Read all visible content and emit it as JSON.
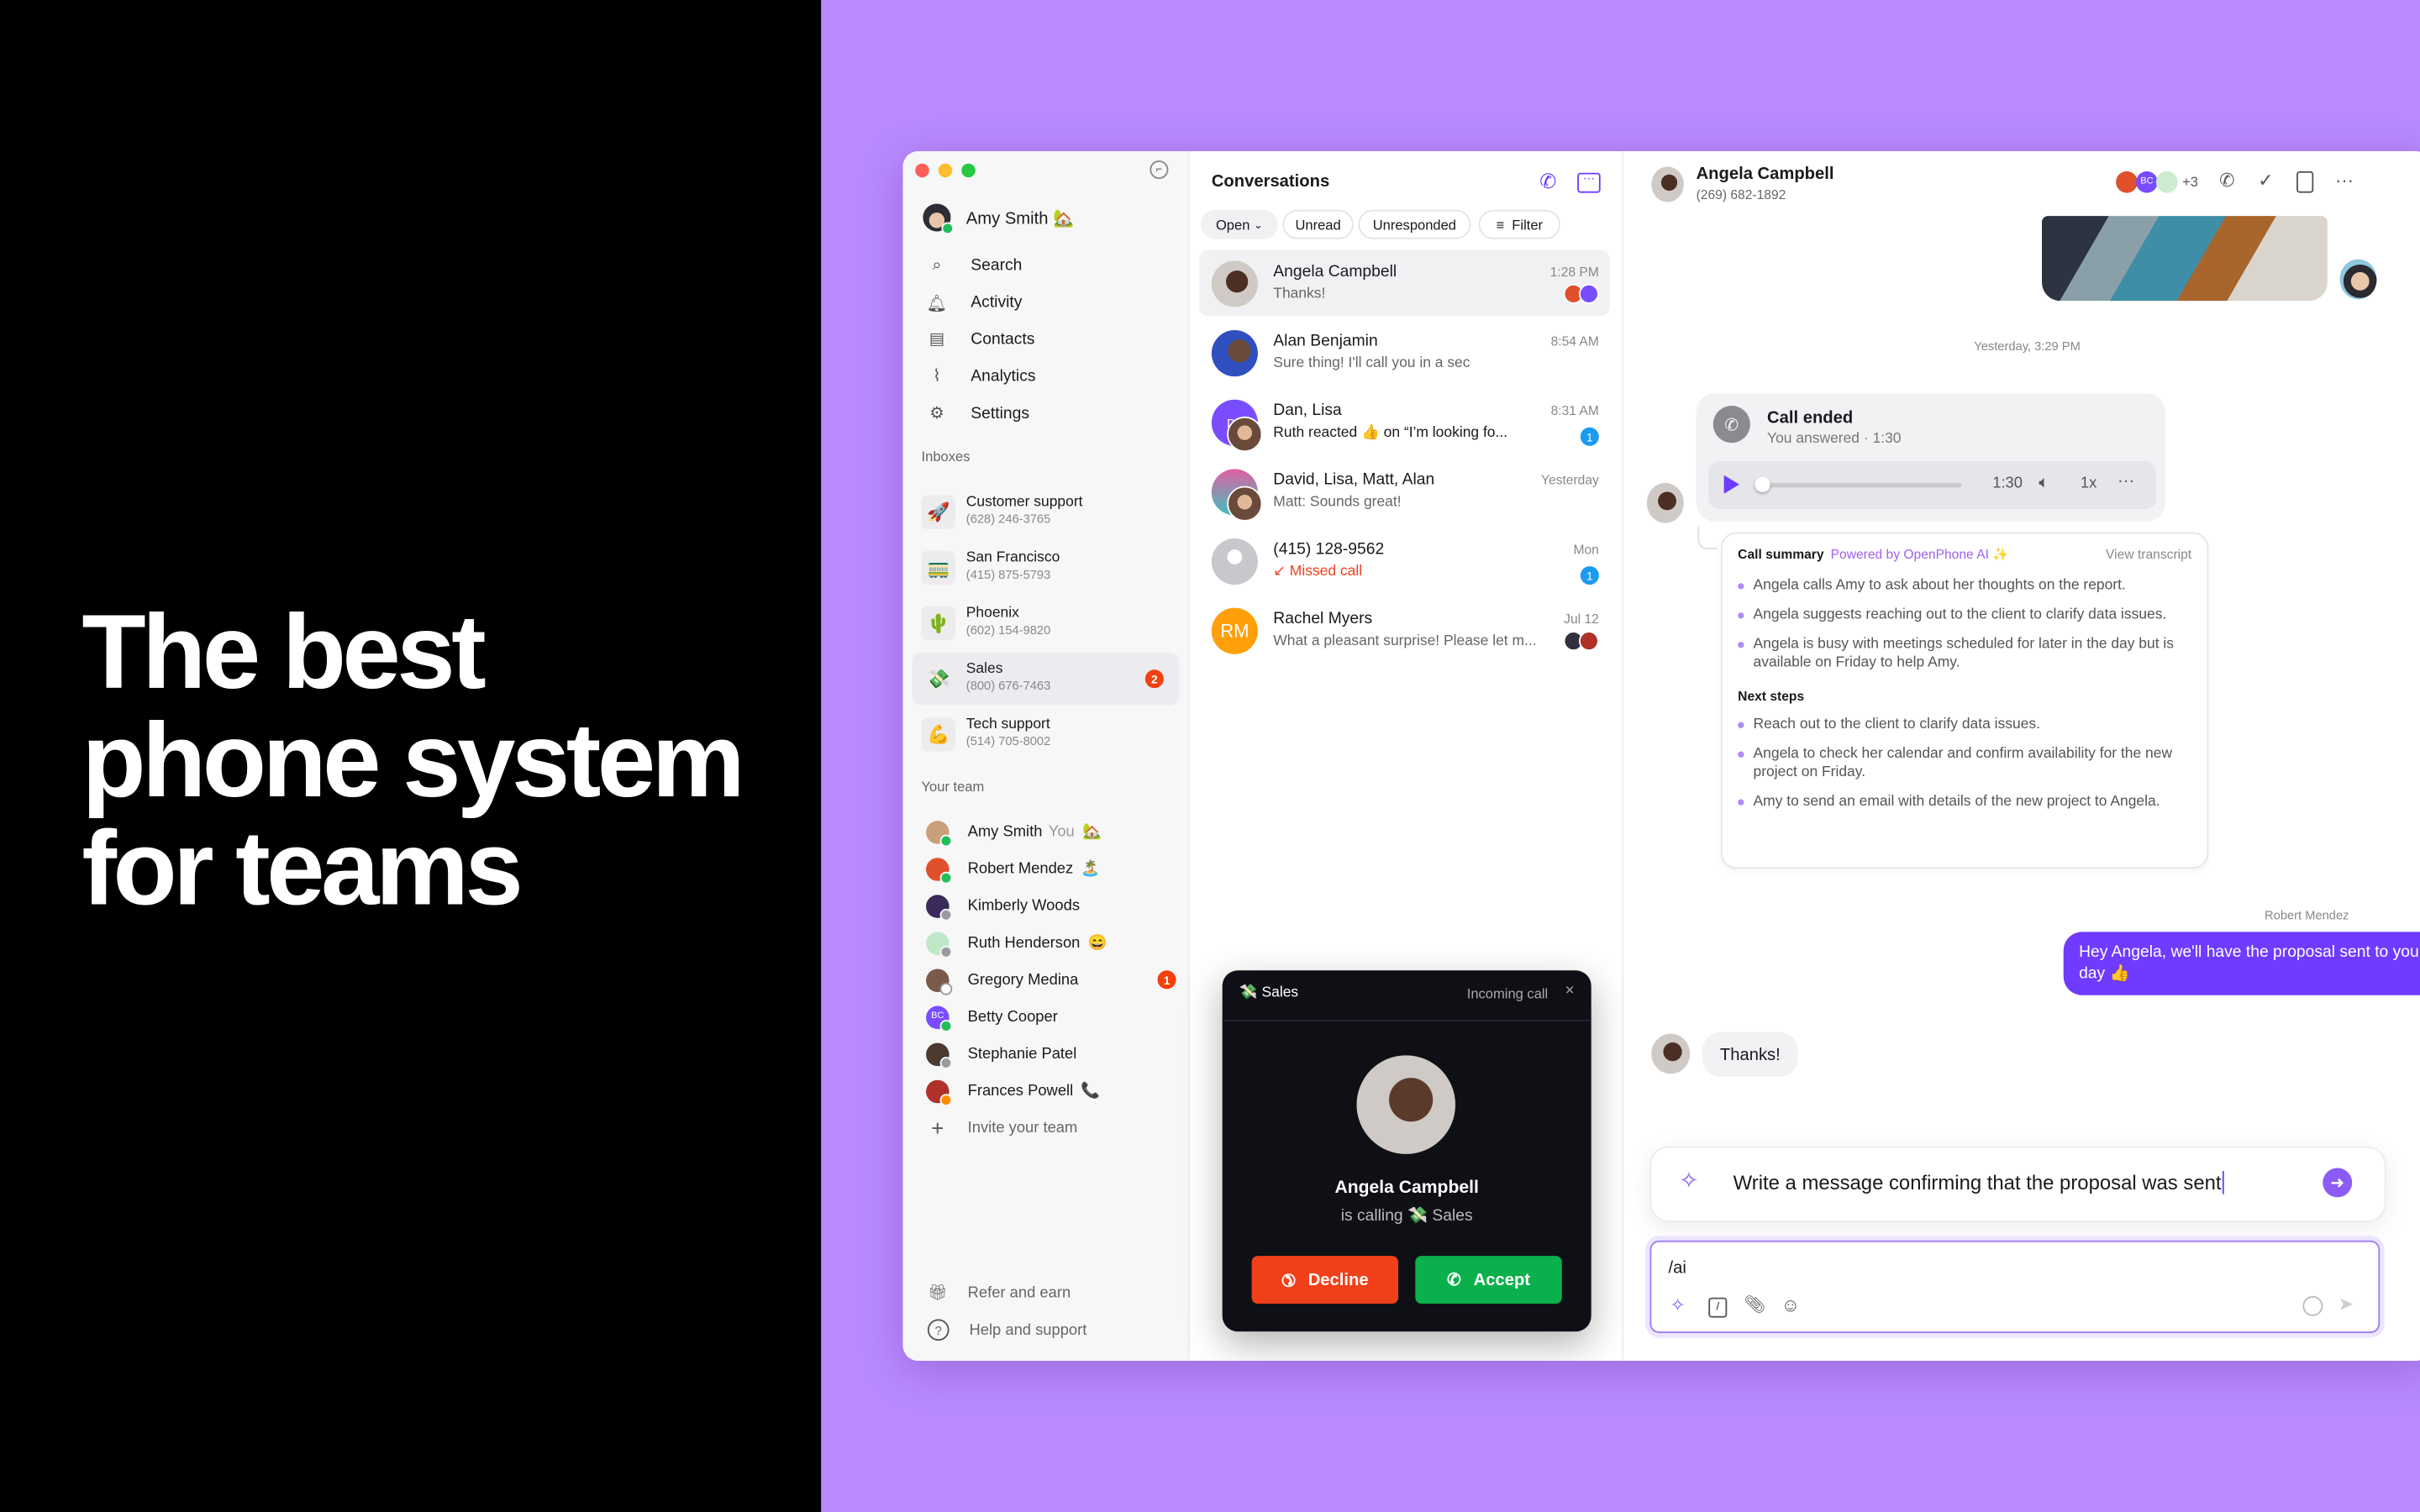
{
  "headline": {
    "line1": "The best",
    "line2": "phone system",
    "line3": "for teams"
  },
  "colors": {
    "accent": "#6f3bff",
    "background": "#b98bff",
    "decline": "#f0401a",
    "accept": "#0ab04b",
    "unread_badge": "#1a9bf0",
    "alert_badge": "#f2400f"
  },
  "sidebar": {
    "user": {
      "name": "Amy Smith",
      "status_emoji": "🏡"
    },
    "nav": [
      {
        "label": "Search",
        "icon": "search-icon"
      },
      {
        "label": "Activity",
        "icon": "bell-icon"
      },
      {
        "label": "Contacts",
        "icon": "contacts-icon"
      },
      {
        "label": "Analytics",
        "icon": "analytics-icon"
      },
      {
        "label": "Settings",
        "icon": "gear-icon"
      }
    ],
    "inboxes_label": "Inboxes",
    "inboxes": [
      {
        "emoji": "🚀",
        "name": "Customer support",
        "phone": "(628) 246-3765"
      },
      {
        "emoji": "🚃",
        "name": "San Francisco",
        "phone": "(415) 875-5793"
      },
      {
        "emoji": "🌵",
        "name": "Phoenix",
        "phone": "(602) 154-9820"
      },
      {
        "emoji": "💸",
        "name": "Sales",
        "phone": "(800) 676-7463",
        "badge": "2"
      },
      {
        "emoji": "💪",
        "name": "Tech support",
        "phone": "(514) 705-8002"
      }
    ],
    "team_label": "Your team",
    "team": [
      {
        "name": "Amy Smith",
        "you": "You",
        "emoji": "🏡",
        "status": "online"
      },
      {
        "name": "Robert Mendez",
        "emoji": "🏝️",
        "status": "online"
      },
      {
        "name": "Kimberly Woods",
        "status": "away"
      },
      {
        "name": "Ruth Henderson",
        "emoji": "😄",
        "status": "away"
      },
      {
        "name": "Gregory Medina",
        "status": "offline",
        "badge": "1"
      },
      {
        "name": "Betty Cooper",
        "initials": "BC",
        "status": "online"
      },
      {
        "name": "Stephanie Patel",
        "status": "away"
      },
      {
        "name": "Frances Powell",
        "emoji": "📞",
        "status": "busy"
      }
    ],
    "invite": "Invite your team",
    "refer": "Refer and earn",
    "help": "Help and support"
  },
  "conversations": {
    "title": "Conversations",
    "filters": {
      "open": "Open",
      "unread": "Unread",
      "unresponded": "Unresponded",
      "filter": "Filter"
    },
    "items": [
      {
        "name": "Angela Campbell",
        "preview": "Thanks!",
        "time": "1:28 PM",
        "selected": true
      },
      {
        "name": "Alan Benjamin",
        "preview": "Sure thing! I'll call you in a sec",
        "time": "8:54 AM"
      },
      {
        "name": "Dan, Lisa",
        "initials": "DL",
        "preview": "Ruth reacted 👍 on “I’m looking fo...",
        "time": "8:31 AM",
        "unread": "1"
      },
      {
        "name": "David, Lisa, Matt, Alan",
        "preview": "Matt: Sounds great!",
        "time": "Yesterday"
      },
      {
        "name": "(415) 128-9562",
        "preview": "Missed call",
        "time": "Mon",
        "unread": "1"
      },
      {
        "name": "Rachel Myers",
        "initials": "RM",
        "preview": "What a pleasant surprise! Please let m...",
        "time": "Jul 12"
      }
    ]
  },
  "incoming_call": {
    "inbox_emoji": "💸",
    "inbox": "Sales",
    "label": "Incoming call",
    "caller": "Angela Campbell",
    "calling_text": "is calling",
    "calling_inbox": "💸 Sales",
    "decline": "Decline",
    "accept": "Accept"
  },
  "chat": {
    "contact_name": "Angela Campbell",
    "contact_phone": "(269) 682-1892",
    "participants_more": "+3",
    "participant_initials": "BC",
    "timestamp": "Yesterday, 3:29 PM",
    "call": {
      "title": "Call ended",
      "subtitle": "You answered · 1:30",
      "duration": "1:30",
      "speed": "1x",
      "progress": 0
    },
    "summary": {
      "title": "Call summary",
      "powered": "Powered by OpenPhone AI ✨",
      "view_transcript": "View transcript",
      "points": [
        "Angela calls Amy to ask about her thoughts on the report.",
        "Angela suggests reaching out to the client to clarify data issues.",
        "Angela is busy with meetings scheduled for later in the day but is available on Friday to help Amy."
      ],
      "next_label": "Next steps",
      "next": [
        "Reach out to the client to clarify data issues.",
        "Angela to check her calendar and confirm availability for the new project on Friday.",
        "Amy to send an email with details of the new project to Angela."
      ]
    },
    "outgoing_sender": "Robert Mendez",
    "outgoing_message": "Hey Angela, we'll have the proposal sent to you by end of day 👍",
    "incoming_message": "Thanks!",
    "ai_prompt": "Write a message confirming that the proposal was sent",
    "composer_value": "/ai"
  }
}
